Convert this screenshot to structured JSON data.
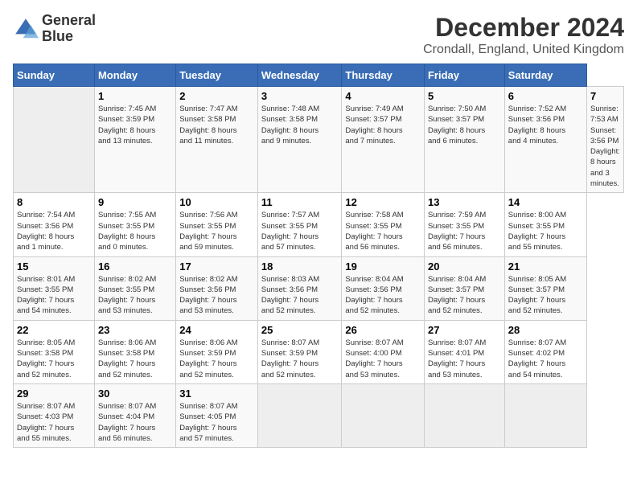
{
  "header": {
    "logo_line1": "General",
    "logo_line2": "Blue",
    "title": "December 2024",
    "subtitle": "Crondall, England, United Kingdom"
  },
  "calendar": {
    "days_of_week": [
      "Sunday",
      "Monday",
      "Tuesday",
      "Wednesday",
      "Thursday",
      "Friday",
      "Saturday"
    ],
    "weeks": [
      [
        {
          "day": "",
          "info": ""
        },
        {
          "day": "1",
          "info": "Sunrise: 7:45 AM\nSunset: 3:59 PM\nDaylight: 8 hours\nand 13 minutes."
        },
        {
          "day": "2",
          "info": "Sunrise: 7:47 AM\nSunset: 3:58 PM\nDaylight: 8 hours\nand 11 minutes."
        },
        {
          "day": "3",
          "info": "Sunrise: 7:48 AM\nSunset: 3:58 PM\nDaylight: 8 hours\nand 9 minutes."
        },
        {
          "day": "4",
          "info": "Sunrise: 7:49 AM\nSunset: 3:57 PM\nDaylight: 8 hours\nand 7 minutes."
        },
        {
          "day": "5",
          "info": "Sunrise: 7:50 AM\nSunset: 3:57 PM\nDaylight: 8 hours\nand 6 minutes."
        },
        {
          "day": "6",
          "info": "Sunrise: 7:52 AM\nSunset: 3:56 PM\nDaylight: 8 hours\nand 4 minutes."
        },
        {
          "day": "7",
          "info": "Sunrise: 7:53 AM\nSunset: 3:56 PM\nDaylight: 8 hours\nand 3 minutes."
        }
      ],
      [
        {
          "day": "8",
          "info": "Sunrise: 7:54 AM\nSunset: 3:56 PM\nDaylight: 8 hours\nand 1 minute."
        },
        {
          "day": "9",
          "info": "Sunrise: 7:55 AM\nSunset: 3:55 PM\nDaylight: 8 hours\nand 0 minutes."
        },
        {
          "day": "10",
          "info": "Sunrise: 7:56 AM\nSunset: 3:55 PM\nDaylight: 7 hours\nand 59 minutes."
        },
        {
          "day": "11",
          "info": "Sunrise: 7:57 AM\nSunset: 3:55 PM\nDaylight: 7 hours\nand 57 minutes."
        },
        {
          "day": "12",
          "info": "Sunrise: 7:58 AM\nSunset: 3:55 PM\nDaylight: 7 hours\nand 56 minutes."
        },
        {
          "day": "13",
          "info": "Sunrise: 7:59 AM\nSunset: 3:55 PM\nDaylight: 7 hours\nand 56 minutes."
        },
        {
          "day": "14",
          "info": "Sunrise: 8:00 AM\nSunset: 3:55 PM\nDaylight: 7 hours\nand 55 minutes."
        }
      ],
      [
        {
          "day": "15",
          "info": "Sunrise: 8:01 AM\nSunset: 3:55 PM\nDaylight: 7 hours\nand 54 minutes."
        },
        {
          "day": "16",
          "info": "Sunrise: 8:02 AM\nSunset: 3:55 PM\nDaylight: 7 hours\nand 53 minutes."
        },
        {
          "day": "17",
          "info": "Sunrise: 8:02 AM\nSunset: 3:56 PM\nDaylight: 7 hours\nand 53 minutes."
        },
        {
          "day": "18",
          "info": "Sunrise: 8:03 AM\nSunset: 3:56 PM\nDaylight: 7 hours\nand 52 minutes."
        },
        {
          "day": "19",
          "info": "Sunrise: 8:04 AM\nSunset: 3:56 PM\nDaylight: 7 hours\nand 52 minutes."
        },
        {
          "day": "20",
          "info": "Sunrise: 8:04 AM\nSunset: 3:57 PM\nDaylight: 7 hours\nand 52 minutes."
        },
        {
          "day": "21",
          "info": "Sunrise: 8:05 AM\nSunset: 3:57 PM\nDaylight: 7 hours\nand 52 minutes."
        }
      ],
      [
        {
          "day": "22",
          "info": "Sunrise: 8:05 AM\nSunset: 3:58 PM\nDaylight: 7 hours\nand 52 minutes."
        },
        {
          "day": "23",
          "info": "Sunrise: 8:06 AM\nSunset: 3:58 PM\nDaylight: 7 hours\nand 52 minutes."
        },
        {
          "day": "24",
          "info": "Sunrise: 8:06 AM\nSunset: 3:59 PM\nDaylight: 7 hours\nand 52 minutes."
        },
        {
          "day": "25",
          "info": "Sunrise: 8:07 AM\nSunset: 3:59 PM\nDaylight: 7 hours\nand 52 minutes."
        },
        {
          "day": "26",
          "info": "Sunrise: 8:07 AM\nSunset: 4:00 PM\nDaylight: 7 hours\nand 53 minutes."
        },
        {
          "day": "27",
          "info": "Sunrise: 8:07 AM\nSunset: 4:01 PM\nDaylight: 7 hours\nand 53 minutes."
        },
        {
          "day": "28",
          "info": "Sunrise: 8:07 AM\nSunset: 4:02 PM\nDaylight: 7 hours\nand 54 minutes."
        }
      ],
      [
        {
          "day": "29",
          "info": "Sunrise: 8:07 AM\nSunset: 4:03 PM\nDaylight: 7 hours\nand 55 minutes."
        },
        {
          "day": "30",
          "info": "Sunrise: 8:07 AM\nSunset: 4:04 PM\nDaylight: 7 hours\nand 56 minutes."
        },
        {
          "day": "31",
          "info": "Sunrise: 8:07 AM\nSunset: 4:05 PM\nDaylight: 7 hours\nand 57 minutes."
        },
        {
          "day": "",
          "info": ""
        },
        {
          "day": "",
          "info": ""
        },
        {
          "day": "",
          "info": ""
        },
        {
          "day": "",
          "info": ""
        }
      ]
    ]
  }
}
